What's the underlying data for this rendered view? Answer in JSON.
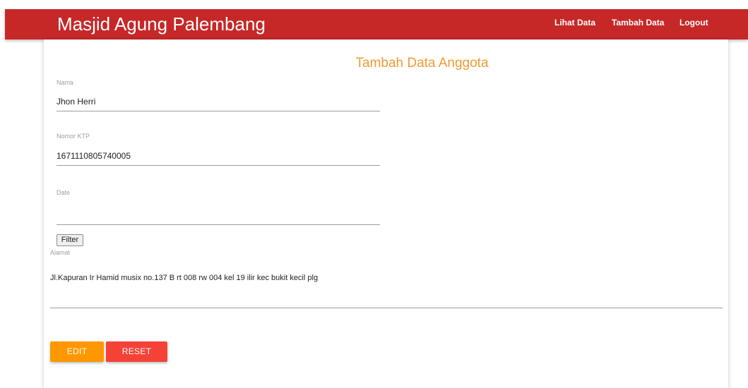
{
  "header": {
    "brand": "Masjid Agung Palembang",
    "nav": {
      "lihat_data": "Lihat Data",
      "tambah_data": "Tambah Data",
      "logout": "Logout"
    },
    "color": "#c62828"
  },
  "form": {
    "title": "Tambah Data Anggota",
    "title_color": "#f09a33",
    "nama": {
      "label": "Nama",
      "value": "Jhon Herri"
    },
    "ktp": {
      "label": "Nomor KTP",
      "value": "1671110805740005"
    },
    "date": {
      "label": "Date",
      "value": ""
    },
    "filter_button": "Filter",
    "alamat": {
      "label": "Alamat",
      "value": "Jl.Kapuran Ir Hamid musix no.137 B rt 008 rw 004 kel 19 ilir kec bukit kecil plg"
    },
    "buttons": {
      "edit": "EDIT",
      "reset": "RESET",
      "edit_color": "#ff9800",
      "reset_color": "#f44336"
    }
  }
}
